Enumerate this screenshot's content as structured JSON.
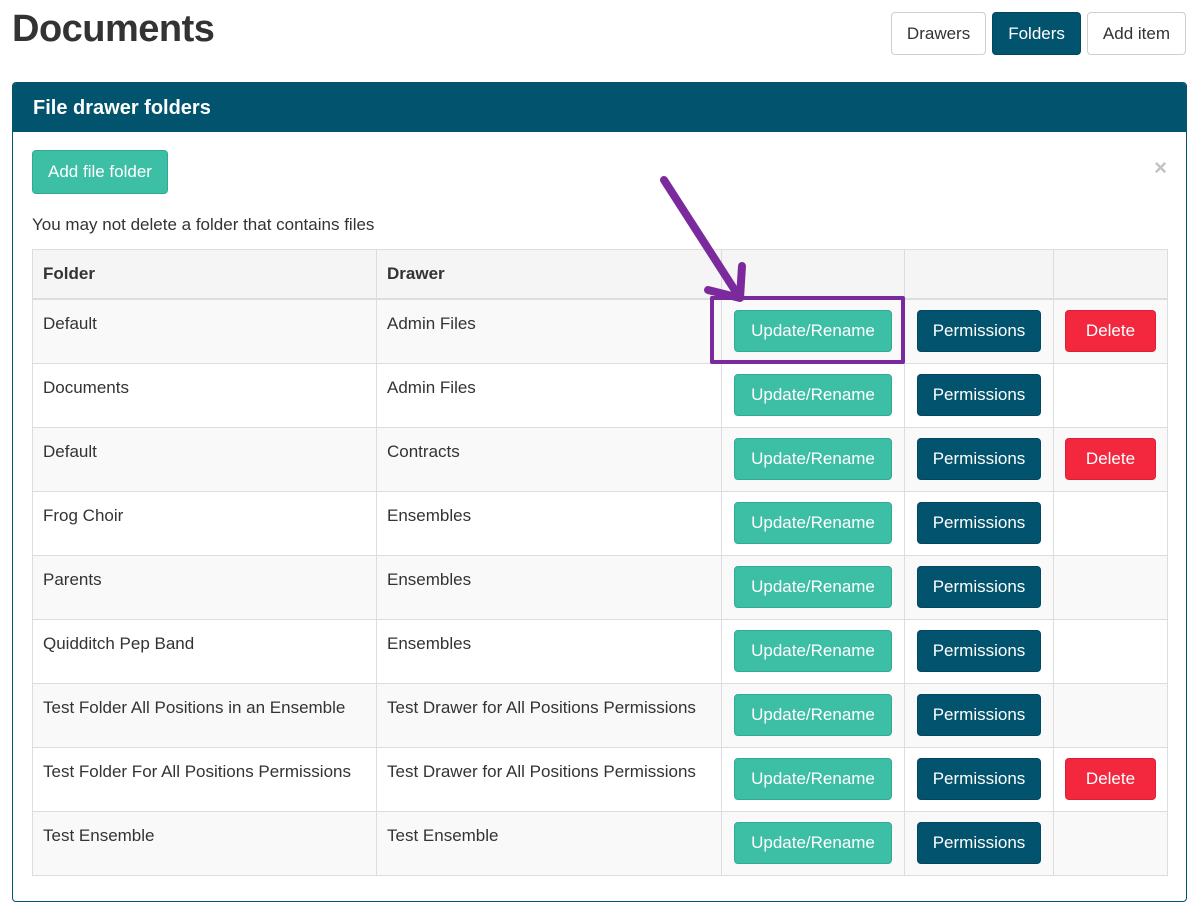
{
  "page": {
    "title": "Documents"
  },
  "top_nav": {
    "drawers_label": "Drawers",
    "folders_label": "Folders",
    "add_item_label": "Add item"
  },
  "panel": {
    "heading": "File drawer folders",
    "add_button_label": "Add file folder",
    "close_symbol": "×",
    "note": "You may not delete a folder that contains files"
  },
  "table": {
    "headers": {
      "folder": "Folder",
      "drawer": "Drawer"
    },
    "action_labels": {
      "update": "Update/Rename",
      "permissions": "Permissions",
      "delete": "Delete"
    },
    "rows": [
      {
        "folder": "Default",
        "drawer": "Admin Files",
        "deletable": true
      },
      {
        "folder": "Documents",
        "drawer": "Admin Files",
        "deletable": false
      },
      {
        "folder": "Default",
        "drawer": "Contracts",
        "deletable": true
      },
      {
        "folder": "Frog Choir",
        "drawer": "Ensembles",
        "deletable": false
      },
      {
        "folder": "Parents",
        "drawer": "Ensembles",
        "deletable": false
      },
      {
        "folder": "Quidditch Pep Band",
        "drawer": "Ensembles",
        "deletable": false
      },
      {
        "folder": "Test Folder All Positions in an Ensemble",
        "drawer": "Test Drawer for All Positions Permissions",
        "deletable": false
      },
      {
        "folder": "Test Folder For All Positions Permissions",
        "drawer": "Test Drawer for All Positions Permissions",
        "deletable": true
      },
      {
        "folder": "Test Ensemble",
        "drawer": "Test Ensemble",
        "deletable": false
      }
    ]
  },
  "annotation": {
    "color": "#7a2a9c",
    "target_row": 0,
    "icon": "arrow-down-right"
  },
  "colors": {
    "primary": "#02546e",
    "success": "#3dbfa6",
    "danger": "#f3283f"
  }
}
